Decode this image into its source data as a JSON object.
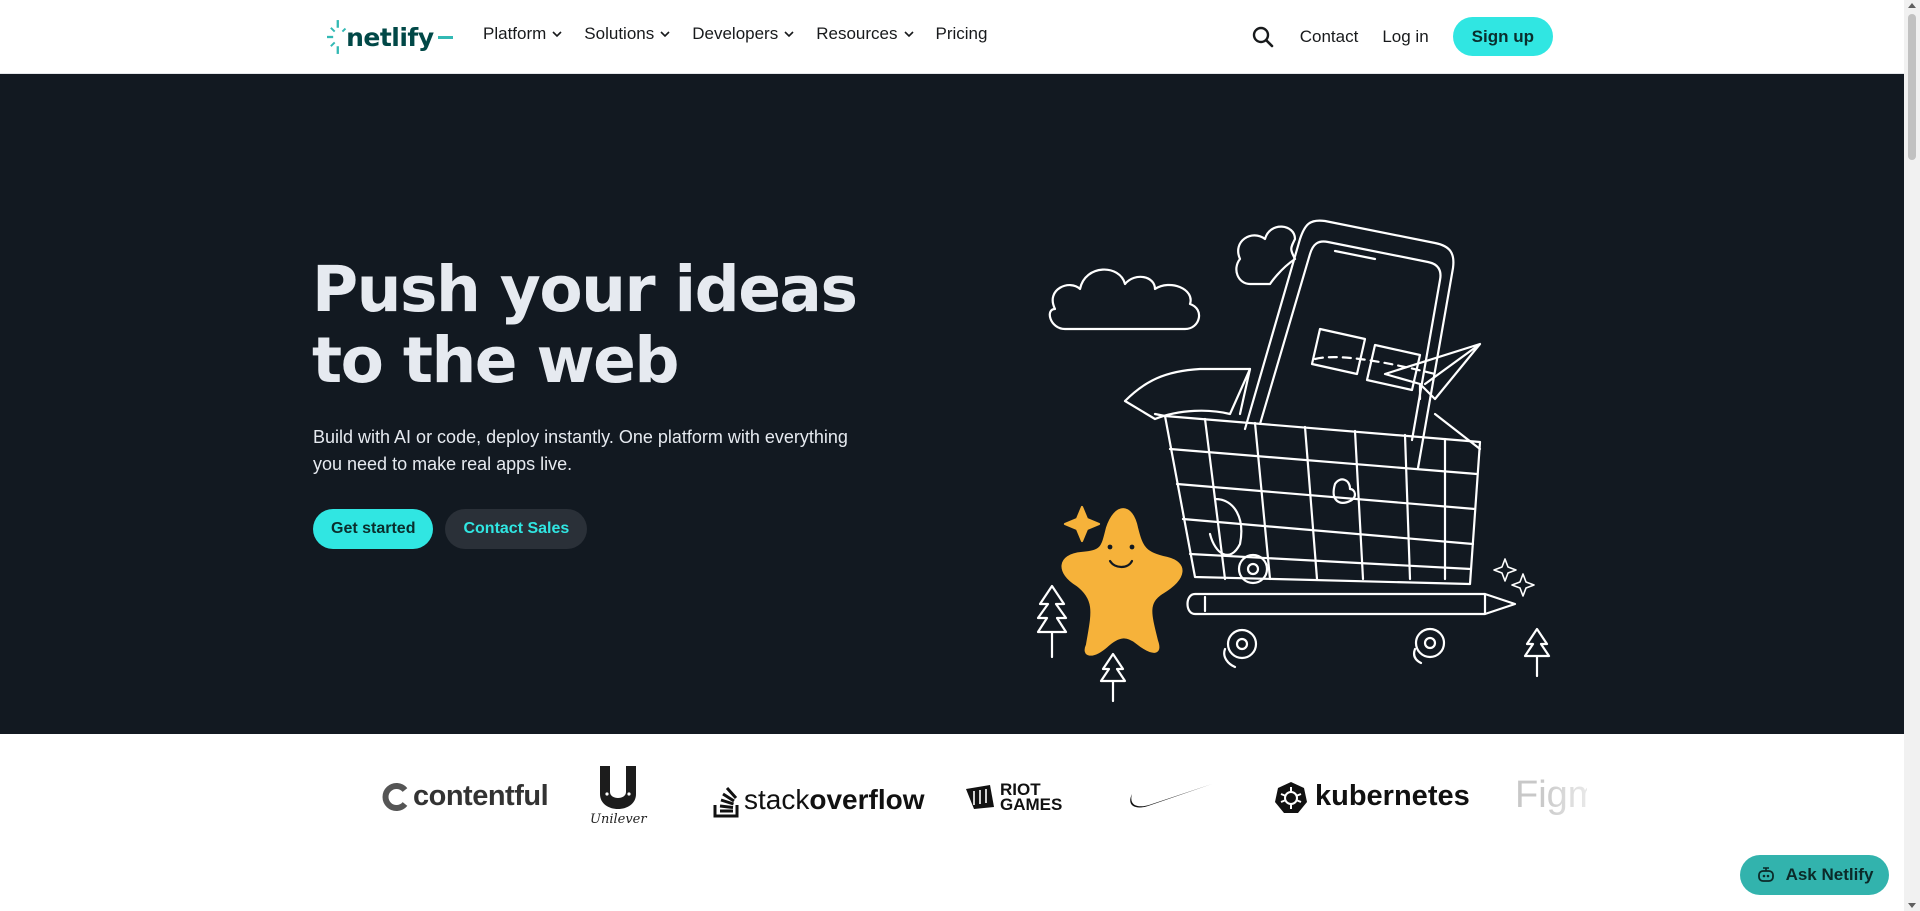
{
  "brand": {
    "name": "netlify",
    "accent": "#30e6e2",
    "dark": "#121921"
  },
  "nav": {
    "items": [
      {
        "label": "Platform",
        "dropdown": true
      },
      {
        "label": "Solutions",
        "dropdown": true
      },
      {
        "label": "Developers",
        "dropdown": true
      },
      {
        "label": "Resources",
        "dropdown": true
      },
      {
        "label": "Pricing",
        "dropdown": false
      }
    ],
    "contact": "Contact",
    "login": "Log in",
    "signup": "Sign up"
  },
  "hero": {
    "title_line1": "Push your ideas",
    "title_line2": "to the web",
    "subtitle_line1": "Build with AI or code, deploy instantly. One platform with everything",
    "subtitle_line2": "you need to make real apps live.",
    "primary_cta": "Get started",
    "secondary_cta": "Contact Sales"
  },
  "logos": {
    "contentful": "contentful",
    "unilever": "Unilever",
    "stackoverflow_a": "stack",
    "stackoverflow_b": "overflow",
    "riot_line1": "RIOT",
    "riot_line2": "GAMES",
    "kubernetes": "kubernetes",
    "figma": "Figma"
  },
  "assistant": {
    "label": "Ask Netlify"
  }
}
